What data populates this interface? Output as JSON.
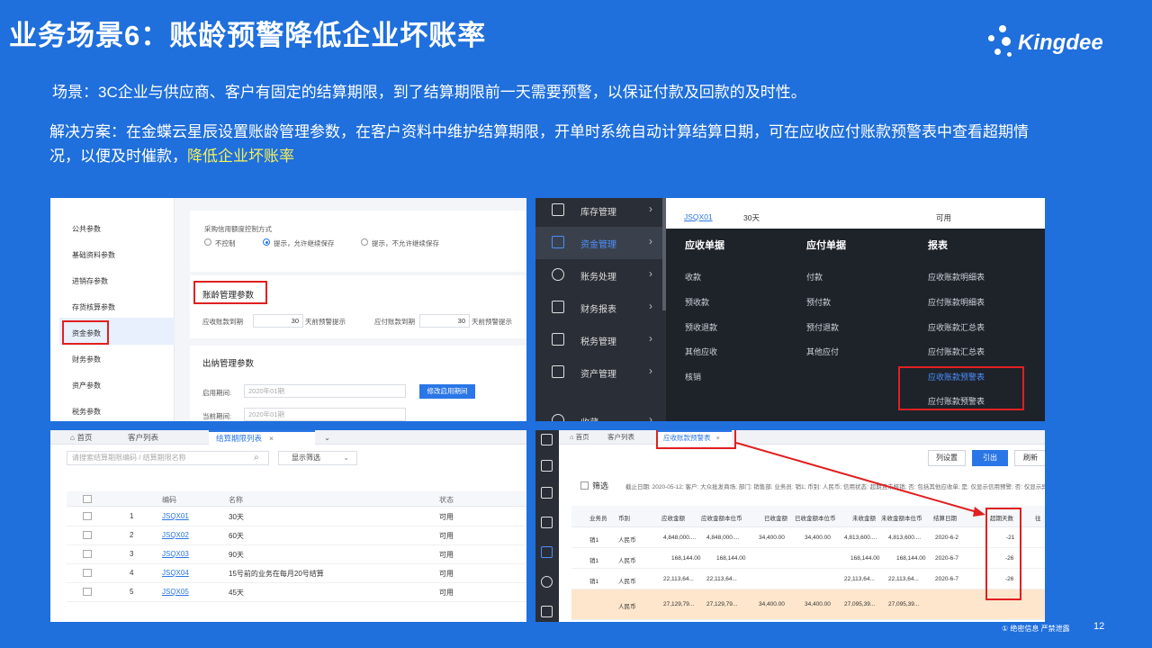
{
  "slide": {
    "title": "业务场景6：账龄预警降低企业坏账率",
    "brand": "Kingdee",
    "scenario": "场景：3C企业与供应商、客户有固定的结算期限，到了结算期限前一天需要预警，以保证付款及回款的及时性。",
    "solution_main": "解决方案：在金蝶云星辰设置账龄管理参数，在客户资料中维护结算期限，开单时系统自动计算结算日期，可在应收应付账款预警表中查看超期情况，以便及时催款，",
    "solution_highlight": "降低企业坏账率",
    "footer": "① 绝密信息 严禁泄露",
    "page_number": "12",
    "colors": {
      "background": "#1f6fdc",
      "highlight": "#f5f05c",
      "red_box": "#e02020",
      "accent": "#2a76e6"
    }
  },
  "panel1": {
    "sidebar": [
      "公共参数",
      "基础资料参数",
      "进销存参数",
      "存货核算参数",
      "资金参数",
      "财务参数",
      "资产参数",
      "税务参数"
    ],
    "credit_label": "采购信用额度控制方式",
    "radio_options": [
      "不控制",
      "提示，允许继续保存",
      "提示，不允许继续保存"
    ],
    "aging_title": "账龄管理参数",
    "receivable_label": "应收账款到期",
    "receivable_value": "30",
    "receivable_suffix": "天前预警提示",
    "payable_label": "应付账款到期",
    "payable_value": "30",
    "payable_suffix": "天前预警提示",
    "cashier_title": "出纳管理参数",
    "start_period_label": "启用期间:",
    "start_period_value": "2020年01期",
    "modify_button": "修改启用期间",
    "current_period_label": "当前期间:",
    "current_period_value": "2020年01期"
  },
  "panel2": {
    "nav": [
      "库存管理",
      "资金管理",
      "账务处理",
      "财务报表",
      "税务管理",
      "资产管理",
      "收藏"
    ],
    "top_code": "JSQX01",
    "top_name": "30天",
    "top_status": "可用",
    "col1_header": "应收单据",
    "col1": [
      "收款",
      "预收款",
      "预收退款",
      "其他应收",
      "核销"
    ],
    "col2_header": "应付单据",
    "col2": [
      "付款",
      "预付款",
      "预付退款",
      "其他应付"
    ],
    "col3_header": "报表",
    "col3": [
      "应收账款明细表",
      "应付账款明细表",
      "应收账款汇总表",
      "应付账款汇总表",
      "应收账款预警表",
      "应付账款预警表"
    ]
  },
  "panel3": {
    "tabs": [
      "首页",
      "客户列表",
      "结算期限列表"
    ],
    "search_placeholder": "请搜索结算期限编码 / 结算期限名称",
    "filter_label": "显示筛选",
    "columns": [
      "编码",
      "名称",
      "状态"
    ],
    "rows": [
      {
        "idx": "1",
        "code": "JSQX01",
        "name": "30天",
        "status": "可用"
      },
      {
        "idx": "2",
        "code": "JSQX02",
        "name": "60天",
        "status": "可用"
      },
      {
        "idx": "3",
        "code": "JSQX03",
        "name": "90天",
        "status": "可用"
      },
      {
        "idx": "4",
        "code": "JSQX04",
        "name": "15号前的业务在每月20号结算",
        "status": "可用"
      },
      {
        "idx": "5",
        "code": "JSQX05",
        "name": "45天",
        "status": "可用"
      }
    ]
  },
  "panel4": {
    "tabs": [
      "首页",
      "客户列表",
      "应收账款预警表"
    ],
    "buttons": [
      "列设置",
      "引出",
      "刷新"
    ],
    "filter_label": "筛选",
    "filter_text": "截止日期: 2020-05-12; 客户: 大众批发商场; 部门: 销售部; 业务员: 销1; 币别: 人民币; 信用状态: 超期且未核销; 否: 包括其他应收单; 是: 仅显示信用预警; 否: 仅显示异常款",
    "columns": [
      "业务员",
      "币别",
      "应收金额",
      "应收金额本位币",
      "已收金额",
      "已收金额本位币",
      "未收金额",
      "未收金额本位币",
      "结算日期",
      "超期天数",
      "往"
    ],
    "rows": [
      [
        "销1",
        "人民币",
        "4,848,000....",
        "4,848,000....",
        "34,400.00",
        "34,400.00",
        "4,813,600....",
        "4,813,600....",
        "2020-6-2",
        "-21"
      ],
      [
        "销1",
        "人民币",
        "168,144.00",
        "168,144.00",
        "",
        "",
        "168,144.00",
        "168,144.00",
        "2020-6-7",
        "-26"
      ],
      [
        "销1",
        "人民币",
        "22,113,64...",
        "22,113,64...",
        "",
        "",
        "22,113,64...",
        "22,113,64...",
        "2020-6-7",
        "-26"
      ]
    ],
    "total_row": [
      "",
      "人民币",
      "27,129,79...",
      "27,129,79...",
      "34,400.00",
      "34,400.00",
      "27,095,39...",
      "27,095,39...",
      "",
      ""
    ]
  }
}
